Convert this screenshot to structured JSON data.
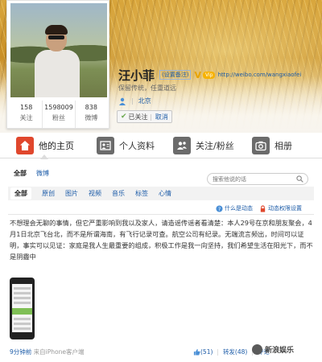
{
  "profile": {
    "name": "汪小菲",
    "remark_label": "(设置备注)",
    "verified_mark": "V",
    "member_badge": "Vip",
    "url": "http://weibo.com/wangxiaofei",
    "signature": "保留传统，任重道远",
    "location": "北京",
    "follow_status": "已关注",
    "follow_cancel": "取消",
    "stats": [
      {
        "num": "158",
        "label": "关注"
      },
      {
        "num": "1598009",
        "label": "粉丝"
      },
      {
        "num": "838",
        "label": "微博"
      }
    ]
  },
  "tabs": [
    {
      "label": "他的主页",
      "icon": "home-icon"
    },
    {
      "label": "个人资料",
      "icon": "profile-icon"
    },
    {
      "label": "关注/粉丝",
      "icon": "follow-icon"
    },
    {
      "label": "相册",
      "icon": "camera-icon"
    }
  ],
  "subnav": {
    "all": "全部",
    "weibo": "微博"
  },
  "search": {
    "placeholder": "搜索他说的话"
  },
  "filters": [
    "全部",
    "原创",
    "图片",
    "视频",
    "音乐",
    "标签",
    "心情"
  ],
  "helpers": {
    "what_is": "什么是动态",
    "settings": "动态权限设置"
  },
  "post": {
    "text": "不想理会无聊的事情，但它严重影响到我以及家人，请造谣传谣者看清楚：本人29号在京和朋友聚会，4月1日北京飞台北，而不是所谓海南，有飞行记录可查。航空公司有纪录。无端流言频出，时间可以证明，事实可以见证：家庭是我人生最重要的组成，积极工作是我一向坚持，我们希望生活在阳光下，而不是阴霾中",
    "time": "9分钟前",
    "source": "来自iPhone客户端",
    "likes": "(51)",
    "forward": "转发(48)",
    "comments": "评论"
  },
  "watermark": "新浪娱乐"
}
